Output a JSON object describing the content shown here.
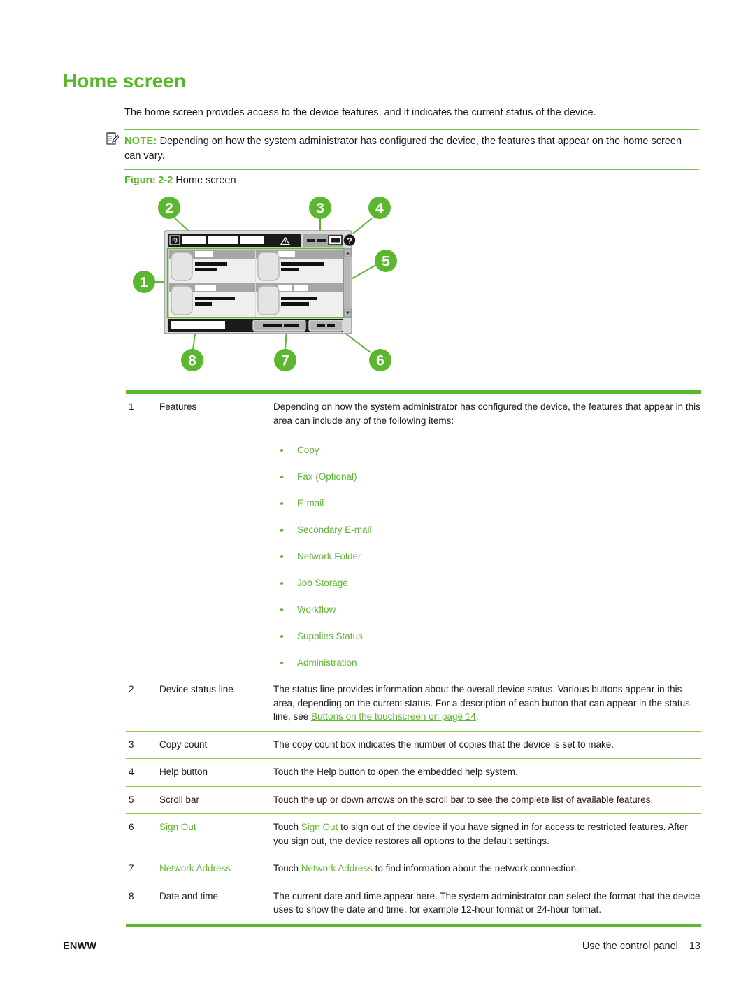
{
  "page": {
    "heading": "Home screen",
    "intro": "The home screen provides access to the device features, and it indicates the current status of the device.",
    "note": {
      "label": "NOTE:",
      "icon": "note-clipboard-icon",
      "text": "Depending on how the system administrator has configured the device, the features that appear on the home screen can vary."
    },
    "figure": {
      "label": "Figure 2-2",
      "title": "Home screen",
      "callouts": [
        "1",
        "2",
        "3",
        "4",
        "5",
        "6",
        "7",
        "8"
      ],
      "accent_color": "#5CB630"
    }
  },
  "table": {
    "rows": [
      {
        "num": "1",
        "name": "Features",
        "name_green": false,
        "desc": "Depending on how the system administrator has configured the device, the features that appear in this area can include any of the following items:",
        "bullets": [
          "Copy",
          "Fax (Optional)",
          "E-mail",
          "Secondary E-mail",
          "Network Folder",
          "Job Storage",
          "Workflow",
          "Supplies Status",
          "Administration"
        ]
      },
      {
        "num": "2",
        "name": "Device status line",
        "name_green": false,
        "desc_pre": "The status line provides information about the overall device status. Various buttons appear in this area, depending on the current status. For a description of each button that can appear in the status line, see ",
        "desc_link": "Buttons on the touchscreen on page 14",
        "desc_post": "."
      },
      {
        "num": "3",
        "name": "Copy count",
        "name_green": false,
        "desc": "The copy count box indicates the number of copies that the device is set to make."
      },
      {
        "num": "4",
        "name": "Help button",
        "name_green": false,
        "desc": "Touch the Help button to open the embedded help system."
      },
      {
        "num": "5",
        "name": "Scroll bar",
        "name_green": false,
        "desc": "Touch the up or down arrows on the scroll bar to see the complete list of available features."
      },
      {
        "num": "6",
        "name": "Sign Out",
        "name_green": true,
        "desc_pre": "Touch ",
        "desc_green": "Sign Out",
        "desc_post": " to sign out of the device if you have signed in for access to restricted features. After you sign out, the device restores all options to the default settings."
      },
      {
        "num": "7",
        "name": "Network Address",
        "name_green": true,
        "desc_pre": "Touch ",
        "desc_green": "Network Address",
        "desc_post": " to find information about the network connection."
      },
      {
        "num": "8",
        "name": "Date and time",
        "name_green": false,
        "desc": "The current date and time appear here. The system administrator can select the format that the device uses to show the date and time, for example 12-hour format or 24-hour format."
      }
    ]
  },
  "footer": {
    "left": "ENWW",
    "right": "Use the control panel",
    "page_number": "13"
  }
}
